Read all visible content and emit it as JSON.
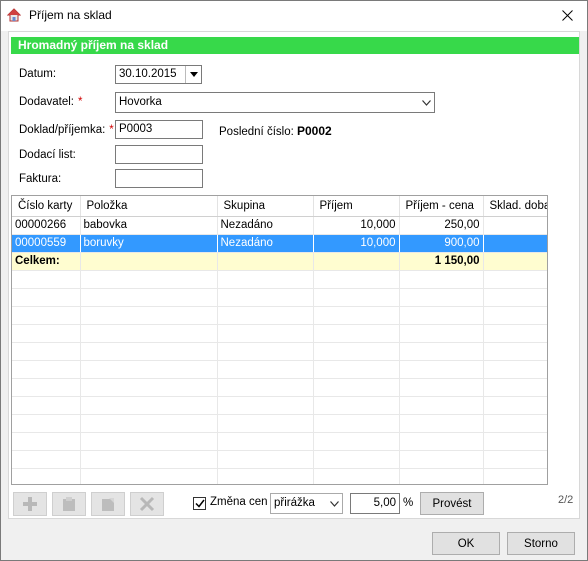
{
  "window": {
    "title": "Příjem na sklad"
  },
  "header": "Hromadný příjem na sklad",
  "form": {
    "datum_label": "Datum:",
    "datum_value": "30.10.2015",
    "dodavatel_label": "Dodavatel:",
    "dodavatel_value": "Hovorka",
    "doklad_label": "Doklad/příjemka:",
    "doklad_value": "P0003",
    "last_number_label": "Poslední číslo:",
    "last_number_value": "P0002",
    "dodaci_label": "Dodací list:",
    "dodaci_value": "",
    "faktura_label": "Faktura:",
    "faktura_value": "",
    "required_mark": "*"
  },
  "table": {
    "columns": [
      "Číslo karty",
      "Položka",
      "Skupina",
      "Příjem",
      "Příjem - cena",
      "Sklad. doba"
    ],
    "rows": [
      [
        "00000266",
        "babovka",
        "Nezadáno",
        "10,000",
        "250,00",
        ""
      ],
      [
        "00000559",
        "boruvky",
        "Nezadáno",
        "10,000",
        "900,00",
        ""
      ]
    ],
    "total": {
      "label": "Celkem:",
      "value": "1 150,00"
    }
  },
  "bottom": {
    "page_indicator": "2/2",
    "zmena_label": "Změna cen",
    "zmena_checked": true,
    "mode_value": "přirážka",
    "percent_value": "5,00",
    "percent_sign": "%",
    "provest_label": "Provést"
  },
  "footer": {
    "ok_label": "OK",
    "storno_label": "Storno"
  },
  "icons": {
    "app": "house-icon",
    "close": "close-icon",
    "add": "plus-icon",
    "edit": "card-edit-icon",
    "note": "note-icon",
    "delete": "x-delete-icon"
  }
}
